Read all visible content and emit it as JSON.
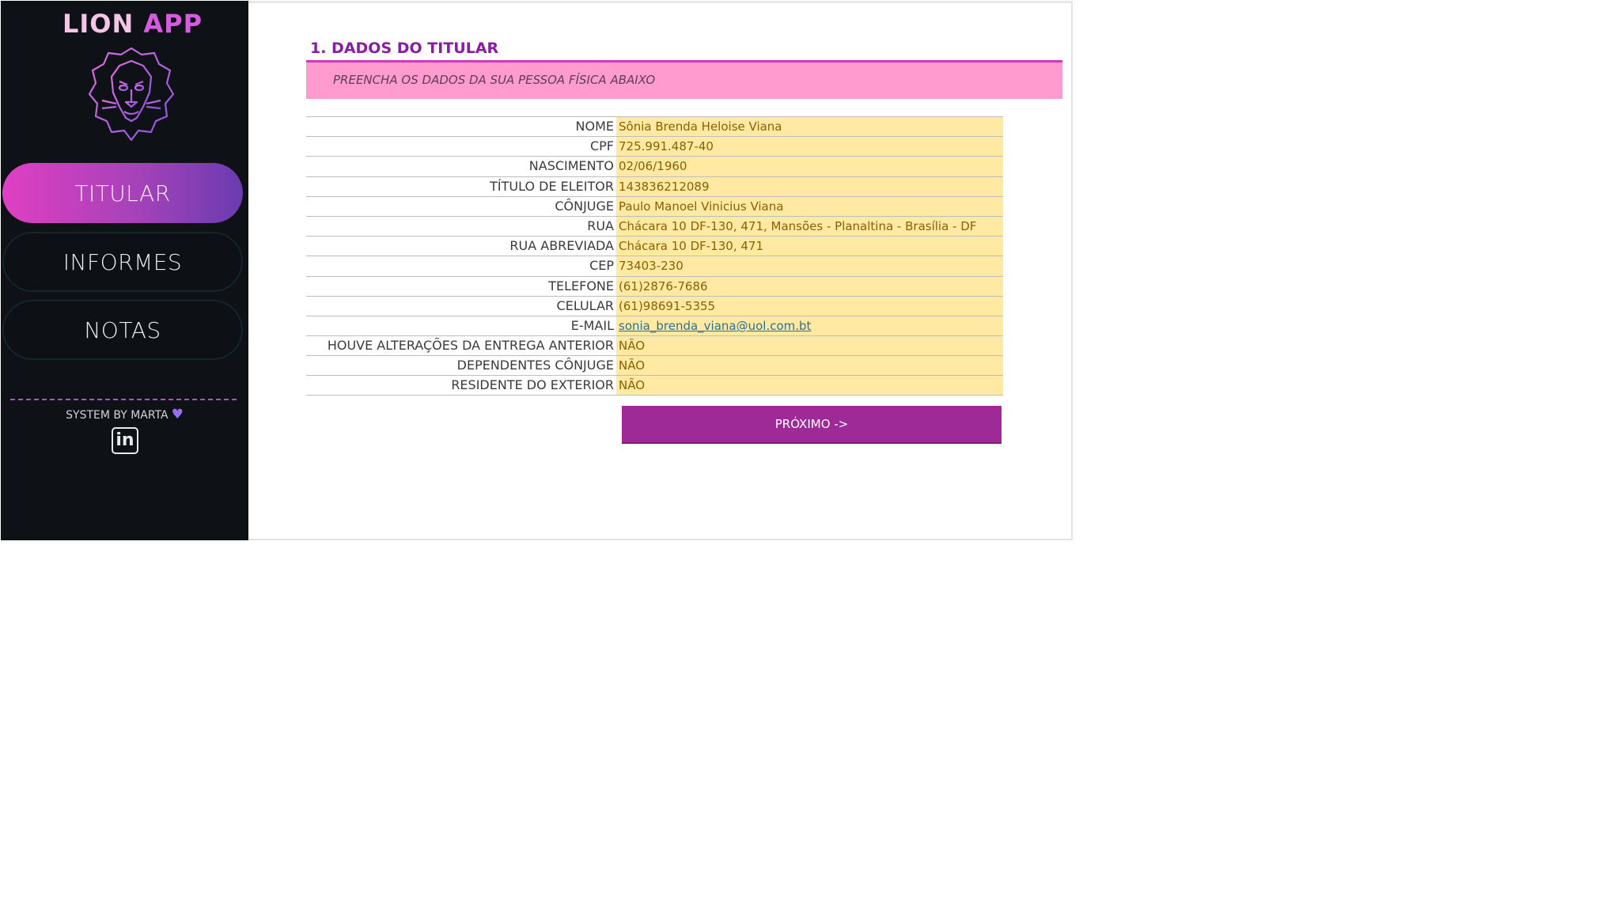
{
  "app": {
    "title_part1": "LION",
    "title_part2": " APP"
  },
  "nav": [
    {
      "label": "TITULAR",
      "active": true
    },
    {
      "label": "INFORMES",
      "active": false
    },
    {
      "label": "NOTAS",
      "active": false
    }
  ],
  "footer": {
    "credit": "SYSTEM BY MARTA",
    "heart_icon": "heart-icon",
    "linkedin_label": "in"
  },
  "section": {
    "title": "1. DADOS DO TITULAR",
    "subtitle": "PREENCHA OS DADOS DA SUA PESSOA FÍSICA ABAIXO"
  },
  "form": {
    "rows": [
      {
        "label": "NOME",
        "value": "Sônia Brenda Heloise Viana"
      },
      {
        "label": "CPF",
        "value": "725.991.487-40"
      },
      {
        "label": "NASCIMENTO",
        "value": "02/06/1960"
      },
      {
        "label": "TÍTULO DE ELEITOR",
        "value": "143836212089"
      },
      {
        "label": "CÔNJUGE",
        "value": "Paulo Manoel Vinicius Viana"
      },
      {
        "label": "RUA",
        "value": "Chácara 10 DF-130, 471,  Mansões  - Planaltina - Brasília - DF"
      },
      {
        "label": "RUA ABREVIADA",
        "value": "Chácara 10 DF-130, 471"
      },
      {
        "label": "CEP",
        "value": "73403-230"
      },
      {
        "label": "TELEFONE",
        "value": "(61)2876-7686"
      },
      {
        "label": "CELULAR",
        "value": "(61)98691-5355"
      },
      {
        "label": "E-MAIL",
        "value": "sonia_brenda_viana@uol.com.bt"
      },
      {
        "label": "HOUVE ALTERAÇÕES DA ENTREGA ANTERIOR",
        "value": "NÃO"
      },
      {
        "label": "DEPENDENTES CÔNJUGE",
        "value": "NÃO"
      },
      {
        "label": "RESIDENTE DO EXTERIOR",
        "value": "NÃO"
      }
    ]
  },
  "next_button": {
    "label": "PRÓXIMO ->"
  },
  "colors": {
    "sidebar_bg": "#0e1116",
    "accent_purple": "#8b1aa8",
    "banner_pink": "#ff9bce",
    "field_bg": "#ffe9a3",
    "button_bg": "#9e2a98"
  }
}
